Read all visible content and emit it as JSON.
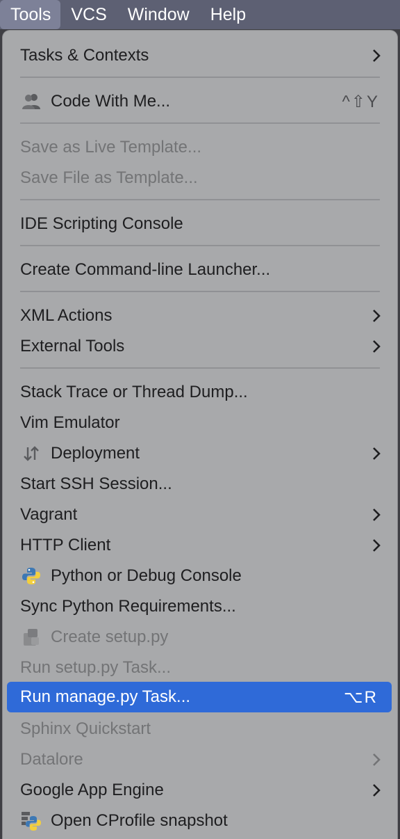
{
  "menubar": {
    "items": [
      "Tools",
      "VCS",
      "Window",
      "Help"
    ]
  },
  "menu": {
    "tasks_contexts": "Tasks & Contexts",
    "code_with_me": "Code With Me...",
    "code_with_me_shortcut": "^⇧Y",
    "save_live_template": "Save as Live Template...",
    "save_file_template": "Save File as Template...",
    "ide_scripting_console": "IDE Scripting Console",
    "create_launcher": "Create Command-line Launcher...",
    "xml_actions": "XML Actions",
    "external_tools": "External Tools",
    "stack_trace": "Stack Trace or Thread Dump...",
    "vim_emulator": "Vim Emulator",
    "deployment": "Deployment",
    "start_ssh": "Start SSH Session...",
    "vagrant": "Vagrant",
    "http_client": "HTTP Client",
    "python_console": "Python or Debug Console",
    "sync_requirements": "Sync Python Requirements...",
    "create_setup": "Create setup.py",
    "run_setup_task": "Run setup.py Task...",
    "run_manage_task": "Run manage.py Task...",
    "run_manage_shortcut": "⌥R",
    "sphinx_quickstart": "Sphinx Quickstart",
    "datalore": "Datalore",
    "google_app_engine": "Google App Engine",
    "open_cprofile": "Open CProfile snapshot"
  },
  "colors": {
    "menubar_bg": "#5d6073",
    "menu_bg": "#a8a9ab",
    "selected_bg": "#2f6ad8"
  }
}
